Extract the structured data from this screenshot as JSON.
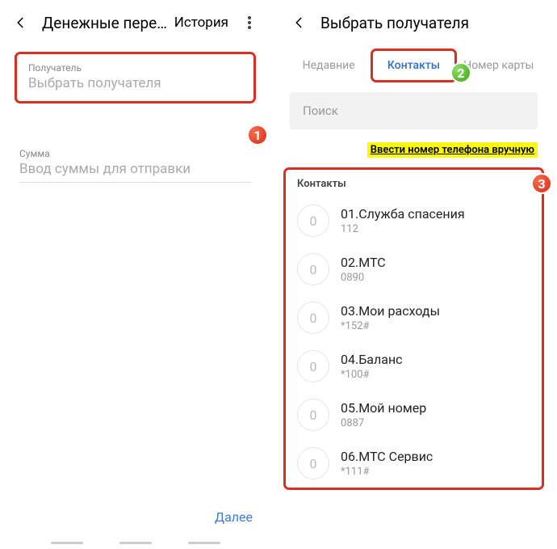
{
  "left": {
    "title": "Денежные пере…",
    "history": "История",
    "recipient_label": "Получатель",
    "recipient_placeholder": "Выбрать получателя",
    "amount_label": "Сумма",
    "amount_placeholder": "Ввод суммы для отправки",
    "next": "Далее"
  },
  "right": {
    "title": "Выбрать получателя",
    "tabs": {
      "recent": "Недавние",
      "contacts": "Контакты",
      "card": "Номер карты"
    },
    "search_placeholder": "Поиск",
    "manual_link": "Ввести номер телефона вручную",
    "section": "Контакты",
    "contacts": [
      {
        "avatar": "0",
        "name": "01.Служба спасения",
        "num": "112"
      },
      {
        "avatar": "0",
        "name": "02.МТС",
        "num": "0890"
      },
      {
        "avatar": "0",
        "name": "03.Мои расходы",
        "num": "*152#"
      },
      {
        "avatar": "0",
        "name": "04.Баланс",
        "num": "*100#"
      },
      {
        "avatar": "0",
        "name": "05.Мой номер",
        "num": "0887"
      },
      {
        "avatar": "0",
        "name": "06.МТС Сервис",
        "num": "*111#"
      }
    ]
  },
  "badges": {
    "b1": "1",
    "b2": "2",
    "b3": "3"
  }
}
